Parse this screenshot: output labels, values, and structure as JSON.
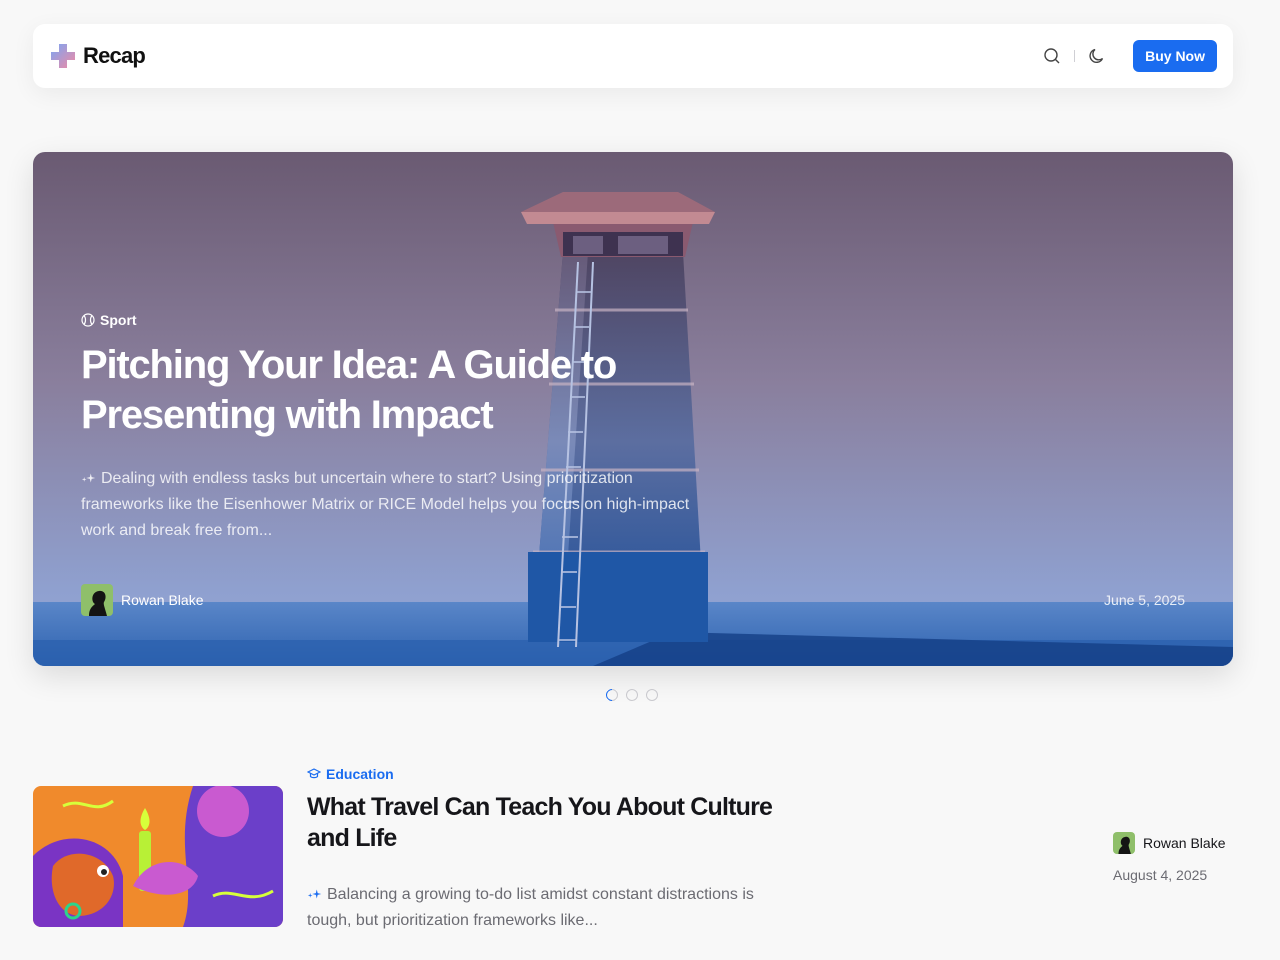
{
  "header": {
    "logo_text": "Recap",
    "buy_label": "Buy Now",
    "accent": "#1a6cf0"
  },
  "hero": {
    "category": "Sport",
    "category_icon": "baseball-icon",
    "title": "Pitching Your Idea: A Guide to Presenting with Impact",
    "excerpt": "Dealing with endless tasks but uncertain where to start? Using prioritization frameworks like the Eisenhower Matrix or RICE Model helps you focus on high-impact work and break free from...",
    "author": "Rowan Blake",
    "date": "June 5, 2025"
  },
  "carousel": {
    "count": 3,
    "active_index": 0
  },
  "articles": [
    {
      "category": "Education",
      "category_icon": "graduation-cap-icon",
      "title": "What Travel Can Teach You About Culture and Life",
      "excerpt": "Balancing a growing to-do list amidst constant distractions is tough, but prioritization frameworks like...",
      "author": "Rowan Blake",
      "date": "August 4, 2025"
    }
  ]
}
